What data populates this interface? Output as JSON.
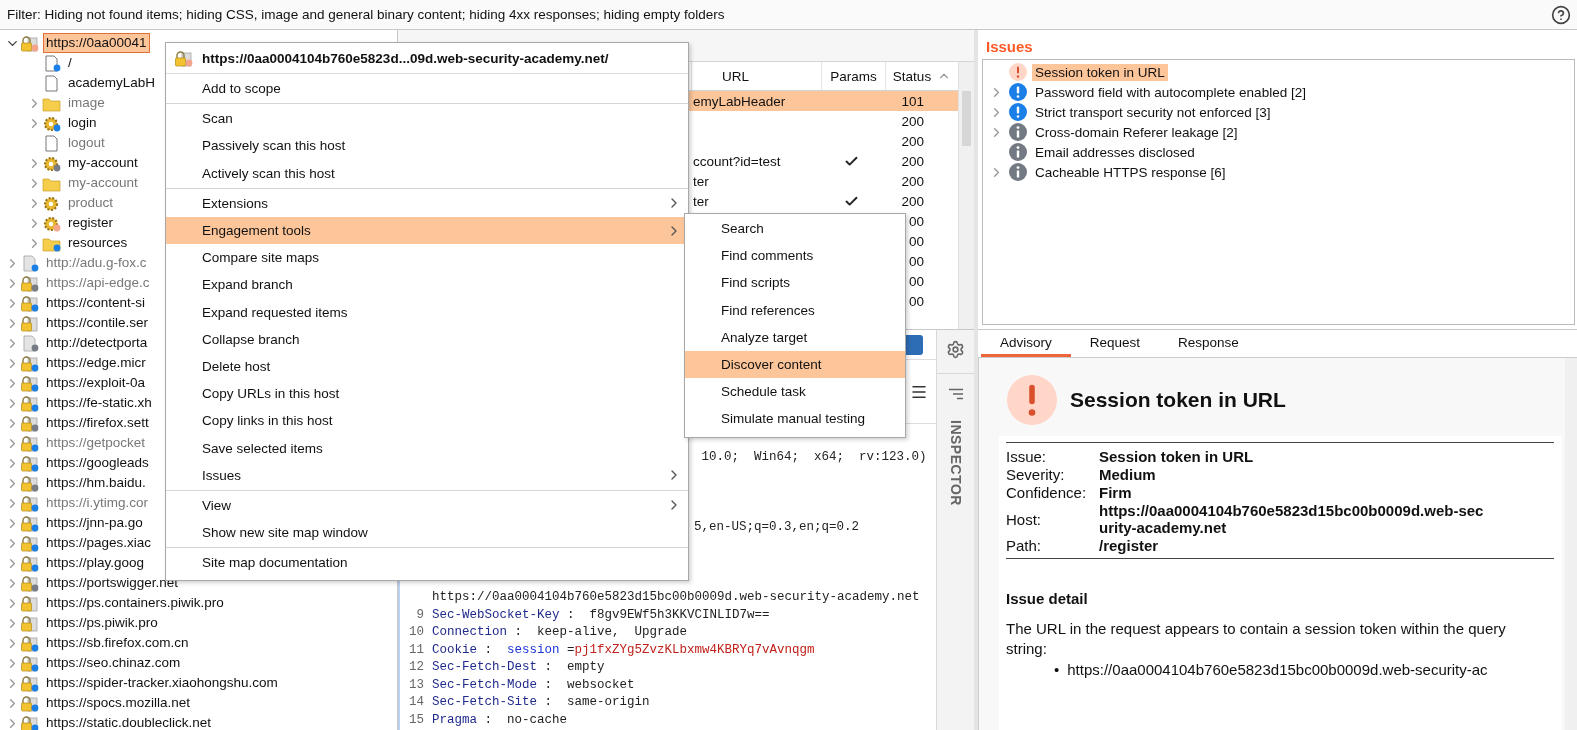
{
  "filter_bar": {
    "text": "Filter: Hiding not found items;  hiding CSS, image and general binary content;  hiding 4xx responses;  hiding empty folders"
  },
  "site_map": [
    {
      "label": "https://0aa00041",
      "kind": "lock",
      "color": "#f4a58c",
      "muted": false,
      "expandable": true,
      "expanded": true,
      "selected": true,
      "children": [
        {
          "label": "/",
          "kind": "page",
          "color": "#1a7fe6",
          "muted": false,
          "expandable": false,
          "selected": false
        },
        {
          "label": "academyLabH",
          "kind": "page",
          "muted": false,
          "expandable": false,
          "selected": false
        },
        {
          "label": "image",
          "kind": "folder",
          "muted": true,
          "expandable": true,
          "expanded": false,
          "selected": false
        },
        {
          "label": "login",
          "kind": "gear",
          "color": "#1a7fe6",
          "muted": false,
          "expandable": true,
          "expanded": false,
          "selected": false
        },
        {
          "label": "logout",
          "kind": "page",
          "muted": true,
          "expandable": false,
          "selected": false
        },
        {
          "label": "my-account",
          "kind": "gear",
          "color": "#777c85",
          "muted": false,
          "expandable": true,
          "expanded": false,
          "selected": false
        },
        {
          "label": "my-account",
          "kind": "folder",
          "muted": true,
          "expandable": true,
          "expanded": false,
          "selected": false
        },
        {
          "label": "product",
          "kind": "gear",
          "muted": true,
          "expandable": true,
          "expanded": false,
          "selected": false
        },
        {
          "label": "register",
          "kind": "gear",
          "color": "#f4a58c",
          "muted": false,
          "expandable": true,
          "expanded": false,
          "selected": false
        },
        {
          "label": "resources",
          "kind": "folder",
          "color": "#1a7fe6",
          "muted": false,
          "expandable": true,
          "expanded": false,
          "selected": false
        }
      ]
    },
    {
      "label": "http://adu.g-fox.c",
      "kind": "server",
      "color": "#1a7fe6",
      "muted": true,
      "expandable": true,
      "expanded": false,
      "selected": false
    },
    {
      "label": "https://api-edge.c",
      "kind": "lock",
      "color": "#777c85",
      "muted": true,
      "expandable": true,
      "expanded": false,
      "selected": false
    },
    {
      "label": "https://content-si",
      "kind": "lock",
      "color": "#1a7fe6",
      "muted": false,
      "expandable": true,
      "expanded": false,
      "selected": false
    },
    {
      "label": "https://contile.ser",
      "kind": "lock",
      "muted": false,
      "expandable": true,
      "expanded": false,
      "selected": false
    },
    {
      "label": "http://detectporta",
      "kind": "server",
      "color": "#777c85",
      "muted": false,
      "expandable": true,
      "expanded": false,
      "selected": false
    },
    {
      "label": "https://edge.micr",
      "kind": "lock",
      "color": "#1a7fe6",
      "muted": false,
      "expandable": true,
      "expanded": false,
      "selected": false
    },
    {
      "label": "https://exploit-0a",
      "kind": "lock",
      "color": "#1a7fe6",
      "muted": false,
      "expandable": true,
      "expanded": false,
      "selected": false
    },
    {
      "label": "https://fe-static.xh",
      "kind": "lock",
      "color": "#1a7fe6",
      "muted": false,
      "expandable": true,
      "expanded": false,
      "selected": false
    },
    {
      "label": "https://firefox.sett",
      "kind": "lock",
      "color": "#777c85",
      "muted": false,
      "expandable": true,
      "expanded": false,
      "selected": false
    },
    {
      "label": "https://getpocket",
      "kind": "lock",
      "color": "#1a7fe6",
      "muted": true,
      "expandable": true,
      "expanded": false,
      "selected": false
    },
    {
      "label": "https://googleads",
      "kind": "lock",
      "color": "#1a7fe6",
      "muted": false,
      "expandable": true,
      "expanded": false,
      "selected": false
    },
    {
      "label": "https://hm.baidu.",
      "kind": "lock",
      "color": "#777c85",
      "muted": false,
      "expandable": true,
      "expanded": false,
      "selected": false
    },
    {
      "label": "https://i.ytimg.cor",
      "kind": "lock",
      "color": "#1a7fe6",
      "muted": true,
      "expandable": true,
      "expanded": false,
      "selected": false
    },
    {
      "label": "https://jnn-pa.go",
      "kind": "lock",
      "color": "#1a7fe6",
      "muted": false,
      "expandable": true,
      "expanded": false,
      "selected": false
    },
    {
      "label": "https://pages.xiac",
      "kind": "lock",
      "color": "#1a7fe6",
      "muted": false,
      "expandable": true,
      "expanded": false,
      "selected": false
    },
    {
      "label": "https://play.goog",
      "kind": "lock",
      "color": "#1a7fe6",
      "muted": false,
      "expandable": true,
      "expanded": false,
      "selected": false
    },
    {
      "label": "https://portswigger.net",
      "kind": "lock",
      "color": "#777c85",
      "muted": false,
      "expandable": true,
      "expanded": false,
      "selected": false
    },
    {
      "label": "https://ps.containers.piwik.pro",
      "kind": "lock",
      "muted": false,
      "expandable": true,
      "expanded": false,
      "selected": false
    },
    {
      "label": "https://ps.piwik.pro",
      "kind": "lock",
      "muted": false,
      "expandable": true,
      "expanded": false,
      "selected": false
    },
    {
      "label": "https://sb.firefox.com.cn",
      "kind": "lock",
      "color": "#1a7fe6",
      "muted": false,
      "expandable": true,
      "expanded": false,
      "selected": false
    },
    {
      "label": "https://seo.chinaz.com",
      "kind": "lock",
      "color": "#1a7fe6",
      "muted": false,
      "expandable": true,
      "expanded": false,
      "selected": false
    },
    {
      "label": "https://spider-tracker.xiaohongshu.com",
      "kind": "lock",
      "color": "#1a7fe6",
      "muted": false,
      "expandable": true,
      "expanded": false,
      "selected": false
    },
    {
      "label": "https://spocs.mozilla.net",
      "kind": "lock",
      "color": "#1a7fe6",
      "muted": false,
      "expandable": true,
      "expanded": false,
      "selected": false
    },
    {
      "label": "https://static.doubleclick.net",
      "kind": "lock",
      "color": "#1a7fe6",
      "muted": false,
      "expandable": true,
      "expanded": false,
      "selected": false
    }
  ],
  "table": {
    "columns": [
      "URL",
      "Params",
      "Status"
    ],
    "rows": [
      {
        "url": "emyLabHeader",
        "params": false,
        "status": "101",
        "selected": true
      },
      {
        "url": "",
        "params": false,
        "status": "200",
        "selected": false
      },
      {
        "url": "",
        "params": false,
        "status": "200",
        "selected": false
      },
      {
        "url": "ccount?id=test",
        "params": true,
        "status": "200",
        "selected": false
      },
      {
        "url": "ter",
        "params": false,
        "status": "200",
        "selected": false
      },
      {
        "url": "ter",
        "params": true,
        "status": "200",
        "selected": false
      },
      {
        "url": "",
        "params": false,
        "status": "00",
        "selected": false
      },
      {
        "url": "",
        "params": false,
        "status": "00",
        "selected": false
      },
      {
        "url": "",
        "params": false,
        "status": "00",
        "selected": false
      },
      {
        "url": "",
        "params": false,
        "status": "00",
        "selected": false
      },
      {
        "url": "",
        "params": false,
        "status": "00",
        "selected": false
      }
    ]
  },
  "request": {
    "lines": [
      {
        "kind": "covered"
      },
      {
        "kind": "clipped",
        "segments": [
          {
            "kind": "plain",
            "text": " 10.0;  Win64;  x64;  rv:123.0)"
          }
        ]
      },
      {
        "kind": "covered"
      },
      {
        "kind": "covered"
      },
      {
        "kind": "covered"
      },
      {
        "kind": "clipped",
        "segments": [
          {
            "kind": "plain",
            "text": "5,en-US;q=0.3,en;q=0.2"
          }
        ]
      },
      {
        "kind": "covered"
      },
      {
        "kind": "covered"
      },
      {
        "kind": "covered"
      },
      {
        "kind": "wrapped",
        "segments": [
          {
            "kind": "plain",
            "text": "https://0aa0004104b760e5823d15bc00b0009d.web-security-academy.net"
          }
        ]
      },
      {
        "kind": "line",
        "number": "9",
        "segments": [
          {
            "kind": "name",
            "text": "Sec-WebSocket-Key"
          },
          {
            "kind": "plain",
            "text": " :  f8gv9EWf5h3KKVCINLID7w=="
          }
        ]
      },
      {
        "kind": "line",
        "number": "10",
        "segments": [
          {
            "kind": "name",
            "text": "Connection"
          },
          {
            "kind": "plain",
            "text": " :  keep-alive,  Upgrade"
          }
        ]
      },
      {
        "kind": "line",
        "number": "11",
        "segments": [
          {
            "kind": "name",
            "text": "Cookie"
          },
          {
            "kind": "plain",
            "text": " :  "
          },
          {
            "kind": "param",
            "text": "session"
          },
          {
            "kind": "plain",
            "text": " ="
          },
          {
            "kind": "secret",
            "text": "pj1fxZYg5ZvzKLbxmw4KBRYq7vAvnqgm"
          }
        ]
      },
      {
        "kind": "line",
        "number": "12",
        "segments": [
          {
            "kind": "name",
            "text": "Sec-Fetch-Dest"
          },
          {
            "kind": "plain",
            "text": " :  empty"
          }
        ]
      },
      {
        "kind": "line",
        "number": "13",
        "segments": [
          {
            "kind": "name",
            "text": "Sec-Fetch-Mode"
          },
          {
            "kind": "plain",
            "text": " :  websocket"
          }
        ]
      },
      {
        "kind": "line",
        "number": "14",
        "segments": [
          {
            "kind": "name",
            "text": "Sec-Fetch-Site"
          },
          {
            "kind": "plain",
            "text": " :  same-origin"
          }
        ]
      },
      {
        "kind": "line",
        "number": "15",
        "segments": [
          {
            "kind": "name",
            "text": "Pragma"
          },
          {
            "kind": "plain",
            "text": " :  no-cache"
          }
        ]
      }
    ]
  },
  "inspector": {
    "label": "INSPECTOR"
  },
  "issues": {
    "title": "Issues",
    "items": [
      {
        "label": "Session token in URL",
        "kind": "medium",
        "expandable": false,
        "selected": true
      },
      {
        "label": "Password field with autocomplete enabled [2]",
        "kind": "low",
        "expandable": true,
        "expanded": false,
        "selected": false
      },
      {
        "label": "Strict transport security not enforced [3]",
        "kind": "low",
        "expandable": true,
        "expanded": false,
        "selected": false
      },
      {
        "label": "Cross-domain Referer leakage [2]",
        "kind": "info",
        "expandable": true,
        "expanded": false,
        "selected": false
      },
      {
        "label": "Email addresses disclosed",
        "kind": "info",
        "expandable": false,
        "selected": false
      },
      {
        "label": "Cacheable HTTPS response [6]",
        "kind": "info",
        "expandable": true,
        "expanded": false,
        "selected": false
      }
    ]
  },
  "advisory": {
    "tabs": [
      {
        "label": "Advisory",
        "selected": true
      },
      {
        "label": "Request",
        "selected": false
      },
      {
        "label": "Response",
        "selected": false
      }
    ],
    "title": "Session token in URL",
    "fields": [
      {
        "label": "Issue:",
        "value": "Session token in URL"
      },
      {
        "label": "Severity:",
        "value": "Medium"
      },
      {
        "label": "Confidence:",
        "value": "Firm"
      },
      {
        "label": "Host:",
        "value": "https://0aa0004104b760e5823d15bc00b0009d.web-security-academy.net"
      },
      {
        "label": "Path:",
        "value": "/register"
      }
    ],
    "detail_heading": "Issue detail",
    "detail_text": "The URL in the request appears to contain a session token within the query string:",
    "bullets": [
      {
        "marker": "•",
        "text": "https://0aa0004104b760e5823d15bc00b0009d.web-security-ac"
      }
    ]
  },
  "context_menu": {
    "header": "https://0aa0004104b760e5823d...09d.web-security-academy.net/",
    "groups": [
      [
        {
          "label": "Add to scope",
          "submenu": false,
          "selected": false
        }
      ],
      [
        {
          "label": "Scan",
          "submenu": false,
          "selected": false
        },
        {
          "label": "Passively scan this host",
          "submenu": false,
          "selected": false
        },
        {
          "label": "Actively scan this host",
          "submenu": false,
          "selected": false
        }
      ],
      [
        {
          "label": "Extensions",
          "submenu": true,
          "selected": false
        },
        {
          "label": "Engagement tools",
          "submenu": true,
          "selected": true
        },
        {
          "label": "Compare site maps",
          "submenu": false,
          "selected": false
        },
        {
          "label": "Expand branch",
          "submenu": false,
          "selected": false
        },
        {
          "label": "Expand requested items",
          "submenu": false,
          "selected": false
        },
        {
          "label": "Collapse branch",
          "submenu": false,
          "selected": false
        },
        {
          "label": "Delete host",
          "submenu": false,
          "selected": false
        },
        {
          "label": "Copy URLs in this host",
          "submenu": false,
          "selected": false
        },
        {
          "label": "Copy links in this host",
          "submenu": false,
          "selected": false
        },
        {
          "label": "Save selected items",
          "submenu": false,
          "selected": false
        },
        {
          "label": "Issues",
          "submenu": true,
          "selected": false
        }
      ],
      [
        {
          "label": "View",
          "submenu": true,
          "selected": false
        },
        {
          "label": "Show new site map window",
          "submenu": false,
          "selected": false
        }
      ],
      [
        {
          "label": "Site map documentation",
          "submenu": false,
          "selected": false
        }
      ]
    ]
  },
  "submenu": {
    "items": [
      {
        "label": "Search",
        "selected": false
      },
      {
        "label": "Find comments",
        "selected": false
      },
      {
        "label": "Find scripts",
        "selected": false
      },
      {
        "label": "Find references",
        "selected": false
      },
      {
        "label": "Analyze target",
        "selected": false
      },
      {
        "label": "Discover content",
        "selected": true
      },
      {
        "label": "Schedule task",
        "selected": false
      },
      {
        "label": "Simulate manual testing",
        "selected": false
      }
    ]
  }
}
